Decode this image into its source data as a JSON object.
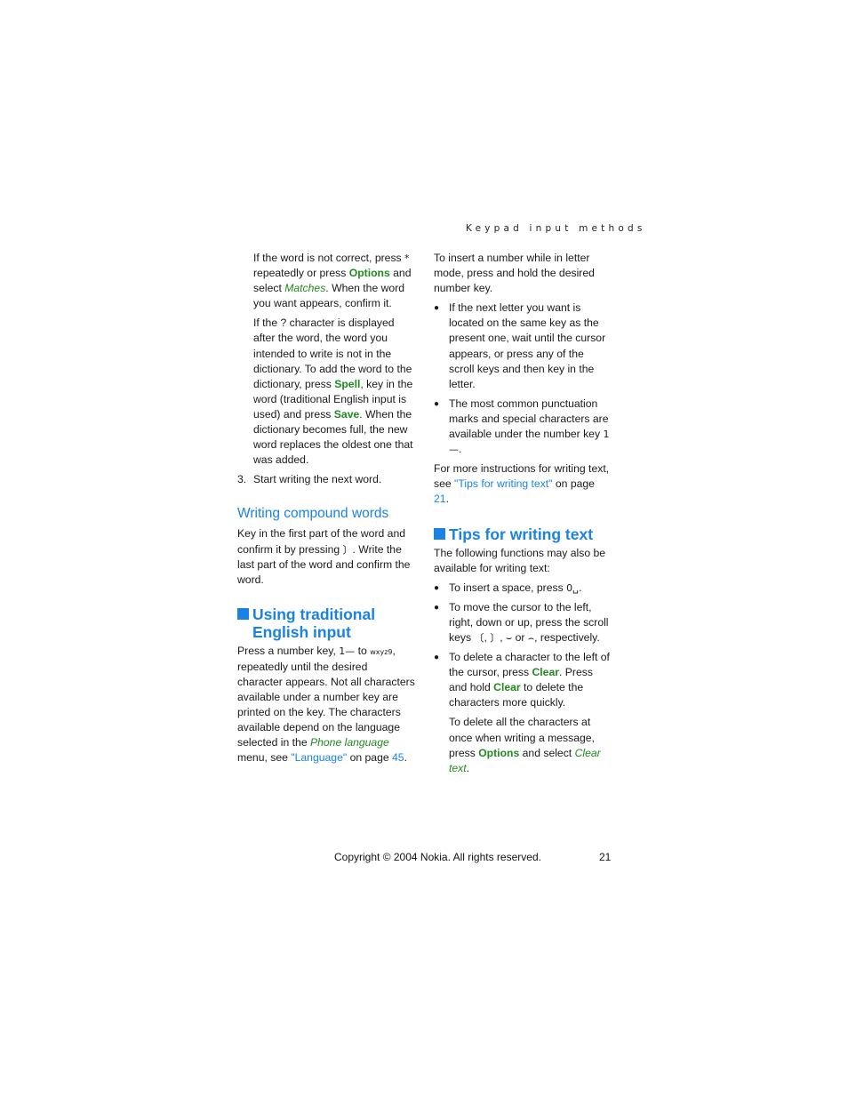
{
  "running_header": "Keypad input methods",
  "col1": {
    "p1": {
      "t1": "If the word is not correct, press ",
      "key_star": "*",
      "t2": " repeatedly or press ",
      "options": "Options",
      "t3": " and select ",
      "matches": "Matches",
      "t4": ". When the word you want appears, confirm it."
    },
    "p2": {
      "t1": "If the ? character is displayed after the word, the word you intended to write is not in the dictionary. To add the word to the dictionary, press ",
      "spell": "Spell",
      "t2": ", key in the word (traditional English input is used) and press ",
      "save": "Save",
      "t3": ". When the dictionary becomes full, the new word replaces the oldest one that was added."
    },
    "step3": {
      "num": "3.",
      "text": "Start writing the next word."
    },
    "compound": {
      "heading": "Writing compound words",
      "t1": "Key in the first part of the word and confirm it by pressing ",
      "key_right": "〕",
      "t2": ". Write the last part of the word and confirm the word."
    },
    "traditional": {
      "heading": "Using traditional English input",
      "t1": "Press a number key, ",
      "key1": "1—",
      "t2": " to ",
      "key9": "wxyz9",
      "t3": ", repeatedly until the desired character appears. Not all characters available under a number key are printed on the key. The characters available depend on the language selected in the ",
      "phone_language": "Phone language",
      "t4": " menu, see ",
      "link": "\"Language\"",
      "t5": " on page ",
      "page": "45",
      "t6": "."
    }
  },
  "col2": {
    "p1": "To insert a number while in letter mode, press and hold the desired number key.",
    "bullet1": "If the next letter you want is located on the same key as the present one, wait until the cursor appears, or press any of the scroll keys and then key in the letter.",
    "bullet2": {
      "t1": " The most common punctuation marks and special characters are available under the number key ",
      "key1": "1—",
      "t2": "."
    },
    "p2": {
      "t1": "For more instructions for writing text, see ",
      "link": "\"Tips for writing text\"",
      "t2": " on page ",
      "page": "21",
      "t3": "."
    },
    "tips": {
      "heading": "Tips for writing text",
      "intro": "The following functions may also be available for writing text:",
      "b1": {
        "t1": "To insert a space, press ",
        "key0": "0␣",
        "t2": "."
      },
      "b2": {
        "t1": "To move the cursor to the left, right, down or up, press the scroll keys ",
        "kl": "〔",
        "sep1": ", ",
        "kr": "〕",
        "sep2": ", ",
        "kd": "⌣",
        "sep3": " or ",
        "ku": "⌢",
        "t2": ", respectively."
      },
      "b3": {
        "t1": "To delete a character to the left of the cursor, press ",
        "clear1": "Clear",
        "t2": ". Press and hold ",
        "clear2": "Clear",
        "t3": " to delete the characters more quickly."
      },
      "b3p": {
        "t1": "To delete all the characters at once when writing a message, press ",
        "options": "Options",
        "t2": " and select ",
        "cleartext": "Clear text",
        "t3": "."
      }
    }
  },
  "footer": {
    "copyright": "Copyright © 2004 Nokia. All rights reserved.",
    "page_number": "21"
  },
  "colors": {
    "link_blue": "#1a82e6",
    "softkey_green": "#1f8a1f"
  }
}
